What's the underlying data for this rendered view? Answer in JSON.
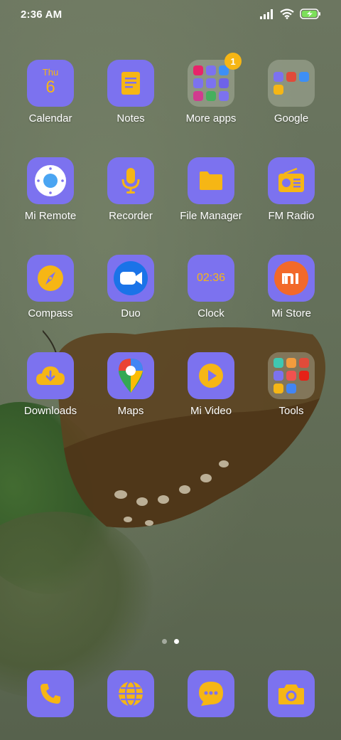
{
  "status_bar": {
    "time": "2:36 AM",
    "icons": [
      "signal-icon",
      "wifi-icon",
      "battery-charging-icon"
    ]
  },
  "apps": [
    {
      "label": "Calendar",
      "icon": "calendar-icon",
      "day": "Thu",
      "date": "6"
    },
    {
      "label": "Notes",
      "icon": "notes-icon"
    },
    {
      "label": "More apps",
      "icon": "folder-icon",
      "badge": "1"
    },
    {
      "label": "Google",
      "icon": "folder-icon"
    },
    {
      "label": "Mi Remote",
      "icon": "remote-icon"
    },
    {
      "label": "Recorder",
      "icon": "microphone-icon"
    },
    {
      "label": "File Manager",
      "icon": "file-folder-icon"
    },
    {
      "label": "FM Radio",
      "icon": "radio-icon"
    },
    {
      "label": "Compass",
      "icon": "compass-icon"
    },
    {
      "label": "Duo",
      "icon": "video-camera-icon"
    },
    {
      "label": "Clock",
      "icon": "clock-icon",
      "time": "02:36"
    },
    {
      "label": "Mi Store",
      "icon": "mi-logo-icon"
    },
    {
      "label": "Downloads",
      "icon": "cloud-download-icon"
    },
    {
      "label": "Maps",
      "icon": "map-pin-icon"
    },
    {
      "label": "Mi Video",
      "icon": "play-icon"
    },
    {
      "label": "Tools",
      "icon": "folder-icon"
    }
  ],
  "dock": [
    {
      "icon": "phone-icon"
    },
    {
      "icon": "browser-globe-icon"
    },
    {
      "icon": "messages-icon"
    },
    {
      "icon": "camera-icon"
    }
  ],
  "page_indicator": {
    "count": 2,
    "active": 2
  },
  "colors": {
    "icon_bg": "#7c72ef",
    "accent": "#f6b615"
  }
}
